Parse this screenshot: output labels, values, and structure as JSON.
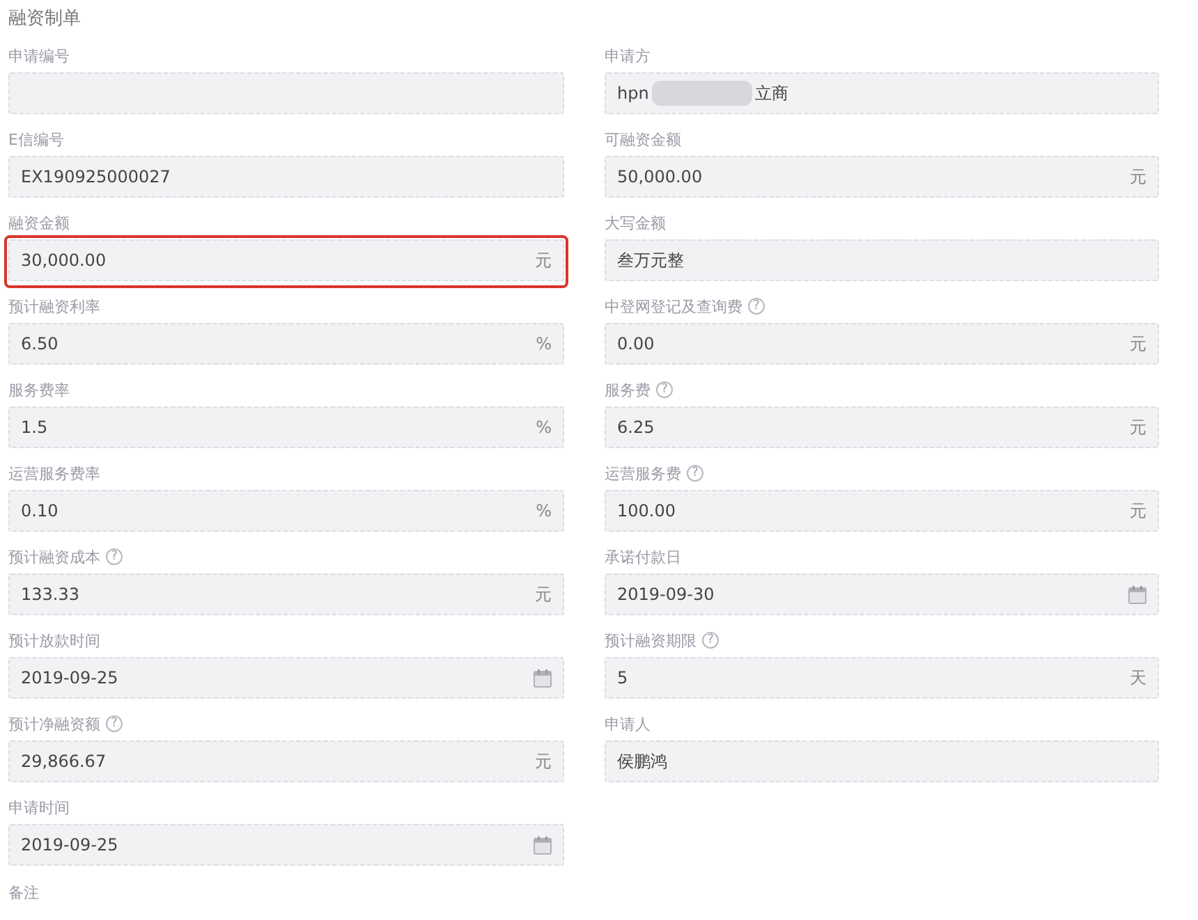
{
  "title": "融资制单",
  "fields": [
    {
      "label": "申请编号",
      "kind": "text",
      "highlighted": false
    },
    {
      "label": "申请方",
      "value": "hpn",
      "redacted_tail": "立商",
      "kind": "text",
      "highlighted": false
    },
    {
      "label": "E信编号",
      "value": "EX190925000027",
      "kind": "text",
      "highlighted": false
    },
    {
      "label": "可融资金额",
      "value": "50,000.00",
      "unit": "元",
      "kind": "text",
      "highlighted": false
    },
    {
      "label": "融资金额",
      "value": "30,000.00",
      "unit": "元",
      "kind": "text",
      "highlighted": true
    },
    {
      "label": "大写金额",
      "value": "叁万元整",
      "kind": "text",
      "highlighted": false
    },
    {
      "label": "预计融资利率",
      "value": "6.50",
      "unit": "%",
      "kind": "text",
      "highlighted": false
    },
    {
      "label": "中登网登记及查询费",
      "help": "?",
      "value": "0.00",
      "unit": "元",
      "kind": "text",
      "highlighted": false
    },
    {
      "label": "服务费率",
      "value": "1.5",
      "unit": "%",
      "kind": "text",
      "highlighted": false
    },
    {
      "label": "服务费",
      "help": "?",
      "value": "6.25",
      "unit": "元",
      "kind": "text",
      "highlighted": false
    },
    {
      "label": "运营服务费率",
      "value": "0.10",
      "unit": "%",
      "kind": "text",
      "highlighted": false
    },
    {
      "label": "运营服务费",
      "help": "?",
      "value": "100.00",
      "unit": "元",
      "kind": "text",
      "highlighted": false
    },
    {
      "label": "预计融资成本",
      "help": "?",
      "value": "133.33",
      "unit": "元",
      "kind": "text",
      "highlighted": false
    },
    {
      "label": "承诺付款日",
      "value": "2019-09-30",
      "kind": "date",
      "highlighted": false
    },
    {
      "label": "预计放款时间",
      "value": "2019-09-25",
      "kind": "date",
      "highlighted": false
    },
    {
      "label": "预计融资期限",
      "help": "?",
      "value": "5",
      "unit": "天",
      "kind": "text",
      "highlighted": false
    },
    {
      "label": "预计净融资额",
      "help": "?",
      "value": "29,866.67",
      "unit": "元",
      "kind": "text",
      "highlighted": false
    },
    {
      "label": "申请人",
      "value": "侯鹏鸿",
      "kind": "text",
      "highlighted": false
    },
    {
      "label": "申请时间",
      "value": "2019-09-25",
      "kind": "date",
      "highlighted": false
    }
  ],
  "remark": {
    "label": "备注"
  }
}
